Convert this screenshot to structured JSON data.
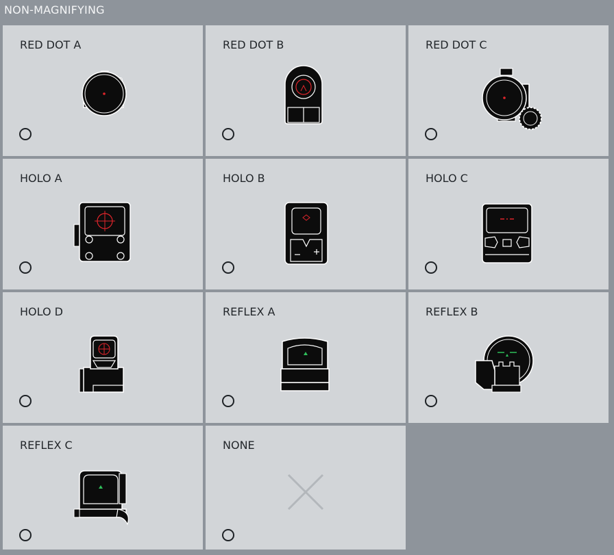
{
  "section": {
    "title": "NON-MAGNIFYING"
  },
  "colors": {
    "background": "#8e949b",
    "card": "#d2d5d8",
    "label": "#23272b",
    "reticle_red": "#e0252b",
    "reticle_green": "#2fbf5a"
  },
  "sights": [
    {
      "label": "RED DOT A",
      "icon": "red-dot-a-icon",
      "selected": false
    },
    {
      "label": "RED DOT B",
      "icon": "red-dot-b-icon",
      "selected": false
    },
    {
      "label": "RED DOT C",
      "icon": "red-dot-c-icon",
      "selected": false
    },
    {
      "label": "HOLO A",
      "icon": "holo-a-icon",
      "selected": false
    },
    {
      "label": "HOLO B",
      "icon": "holo-b-icon",
      "selected": false
    },
    {
      "label": "HOLO C",
      "icon": "holo-c-icon",
      "selected": false
    },
    {
      "label": "HOLO D",
      "icon": "holo-d-icon",
      "selected": false
    },
    {
      "label": "REFLEX A",
      "icon": "reflex-a-icon",
      "selected": false
    },
    {
      "label": "REFLEX B",
      "icon": "reflex-b-icon",
      "selected": false
    },
    {
      "label": "REFLEX C",
      "icon": "reflex-c-icon",
      "selected": false
    },
    {
      "label": "NONE",
      "icon": "none-x-icon",
      "selected": false
    }
  ]
}
